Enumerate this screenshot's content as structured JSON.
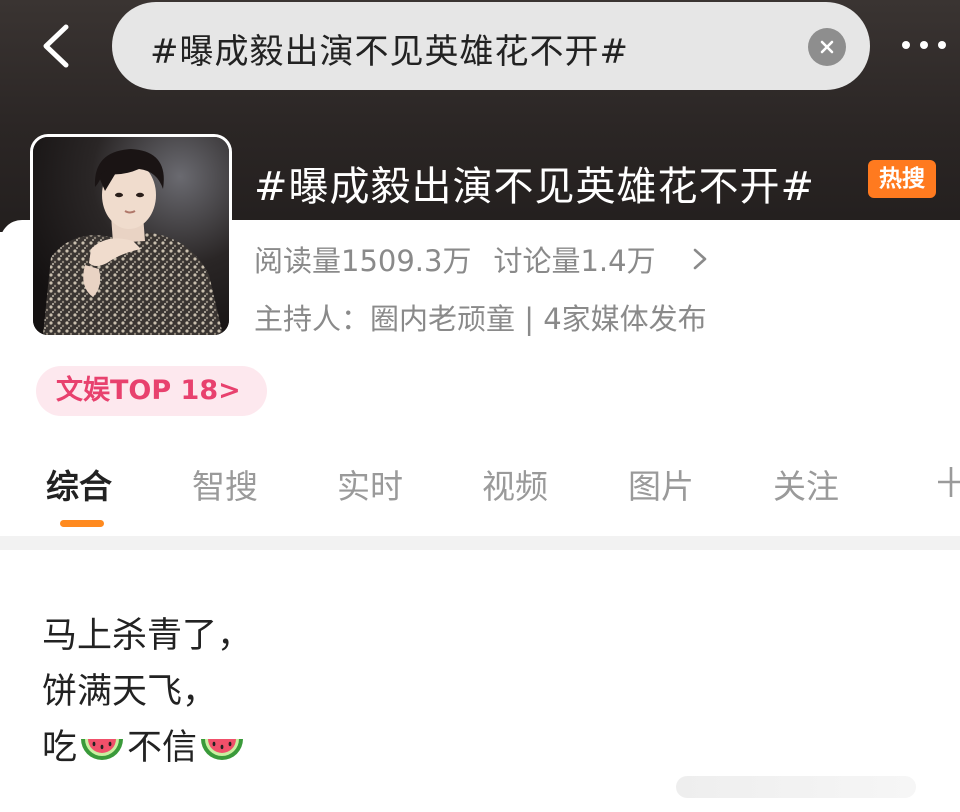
{
  "search": {
    "query": "#曝成毅出演不见英雄花不开#"
  },
  "topic": {
    "title": "#曝成毅出演不见英雄花不开#",
    "hot_badge": "热搜",
    "reads": "阅读量1509.3万",
    "discussions": "讨论量1.4万",
    "host_line": "主持人：圈内老顽童 | 4家媒体发布",
    "rank_label": "文娱TOP 18",
    "rank_chevron": ">"
  },
  "tabs": [
    {
      "label": "综合",
      "active": true
    },
    {
      "label": "智搜",
      "active": false
    },
    {
      "label": "实时",
      "active": false
    },
    {
      "label": "视频",
      "active": false
    },
    {
      "label": "图片",
      "active": false
    },
    {
      "label": "关注",
      "active": false
    }
  ],
  "post": {
    "line1": "马上杀青了，",
    "line2": "饼满天飞，",
    "line3_a": "吃",
    "line3_b": "不信"
  },
  "icons": {
    "back": "chevron-left-icon",
    "clear": "clear-icon",
    "more": "more-dots-icon",
    "watermelon": "watermelon-emoji-icon",
    "add_tab": "plus-icon"
  },
  "colors": {
    "header_bg": "#2b2625",
    "hot_badge": "#ff7a1f",
    "rank_text": "#e8416e",
    "rank_bg": "#fde8ee",
    "tab_underline": "#ff8a1f"
  }
}
